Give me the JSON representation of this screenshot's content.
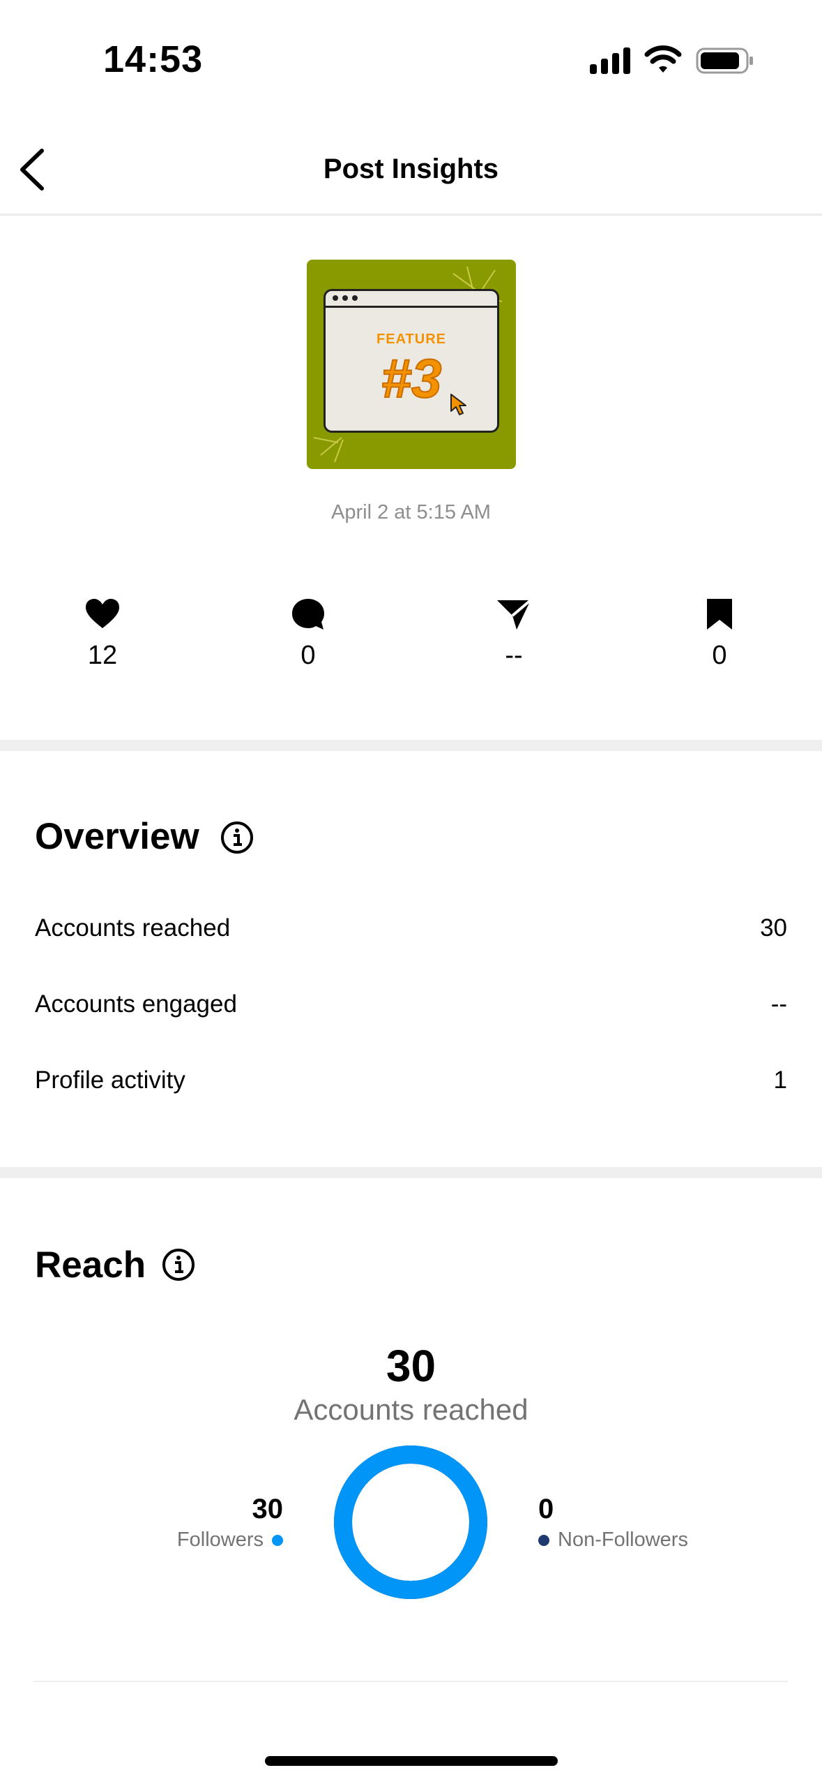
{
  "status_bar": {
    "time": "14:53"
  },
  "header": {
    "title": "Post Insights",
    "back_icon": "chevron-left-icon"
  },
  "post": {
    "thumbnail_label": "FEATURE",
    "thumbnail_number": "#3",
    "thumbnail_bg": "#889a00",
    "accent": "#f39200",
    "date": "April 2 at 5:15 AM"
  },
  "metrics": [
    {
      "icon": "heart-icon",
      "value": "12"
    },
    {
      "icon": "comment-icon",
      "value": "0"
    },
    {
      "icon": "share-icon",
      "value": "--"
    },
    {
      "icon": "bookmark-icon",
      "value": "0"
    }
  ],
  "overview": {
    "title": "Overview",
    "rows": [
      {
        "label": "Accounts reached",
        "value": "30"
      },
      {
        "label": "Accounts engaged",
        "value": "--"
      },
      {
        "label": "Profile activity",
        "value": "1"
      }
    ]
  },
  "reach": {
    "title": "Reach",
    "total": "30",
    "total_label": "Accounts reached",
    "followers": {
      "value": "30",
      "label": "Followers",
      "color": "#0095f6"
    },
    "non_followers": {
      "value": "0",
      "label": "Non-Followers",
      "color": "#1e3a6e"
    },
    "followers_fraction": 1.0
  }
}
